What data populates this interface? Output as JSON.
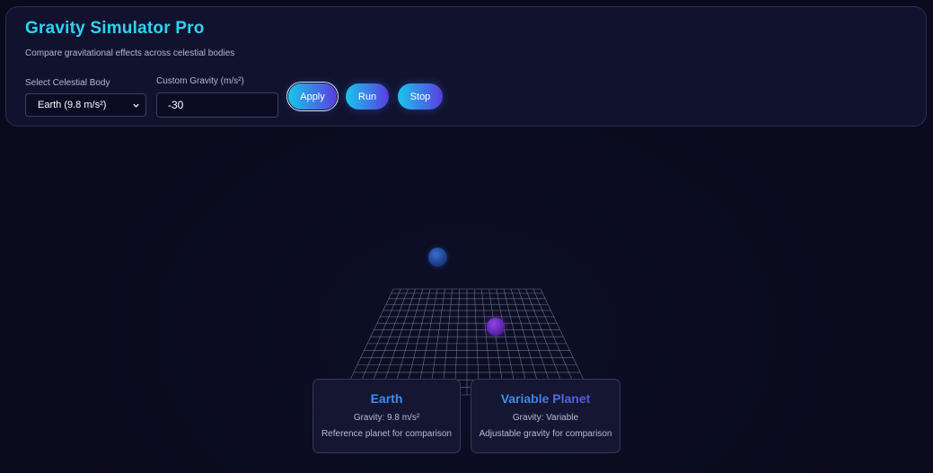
{
  "header": {
    "title": "Gravity Simulator Pro",
    "subtitle": "Compare gravitational effects across celestial bodies"
  },
  "controls": {
    "body_label": "Select Celestial Body",
    "body_selected": "Earth (9.8 m/s²)",
    "gravity_label": "Custom Gravity (m/s²)",
    "gravity_value": "-30",
    "apply_label": "Apply",
    "run_label": "Run",
    "stop_label": "Stop"
  },
  "cards": [
    {
      "name": "Earth",
      "gravity": "Gravity: 9.8 m/s²",
      "description": "Reference planet for comparison"
    },
    {
      "name": "Variable Planet",
      "gravity": "Gravity: Variable",
      "description": "Adjustable gravity for comparison"
    }
  ],
  "colors": {
    "title": "#2fd3f2",
    "button_gradient_start": "#19c6ea",
    "button_gradient_end": "#5b3ce0",
    "earth_ball": "#1c3f8a",
    "variable_ball": "#5e23b0",
    "grid_line": "#8a8fb0"
  },
  "icons": {
    "select_arrow": "chevron-down-icon"
  }
}
